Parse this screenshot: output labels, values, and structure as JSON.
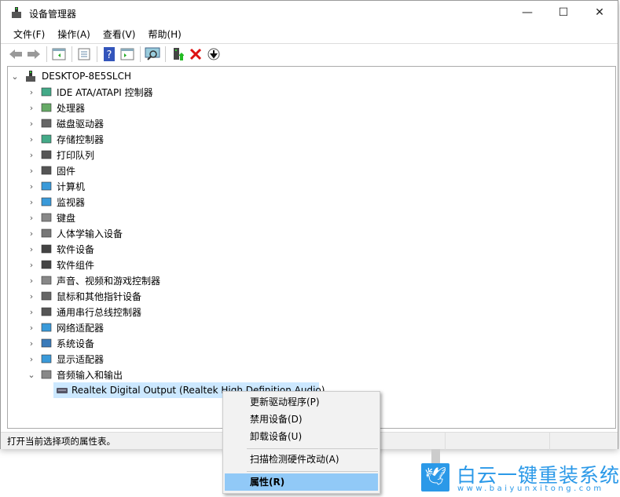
{
  "window": {
    "title": "设备管理器",
    "minimize": "—",
    "maximize": "☐",
    "close": "✕"
  },
  "menu": [
    "文件(F)",
    "操作(A)",
    "查看(V)",
    "帮助(H)"
  ],
  "toolbar": [
    "back",
    "forward",
    "show-hide-console",
    "properties",
    "help",
    "action-pane",
    "scan-hardware",
    "update-driver",
    "uninstall",
    "disable"
  ],
  "tree": {
    "root": "DESKTOP-8E5SLCH",
    "categories": [
      "IDE ATA/ATAPI 控制器",
      "处理器",
      "磁盘驱动器",
      "存储控制器",
      "打印队列",
      "固件",
      "计算机",
      "监视器",
      "键盘",
      "人体学输入设备",
      "软件设备",
      "软件组件",
      "声音、视频和游戏控制器",
      "鼠标和其他指针设备",
      "通用串行总线控制器",
      "网络适配器",
      "系统设备",
      "显示适配器",
      "音频输入和输出"
    ],
    "expanded_child": "Realtek Digital Output (Realtek High Definition Audio)"
  },
  "status": "打开当前选择项的属性表。",
  "context_menu": {
    "items": [
      "更新驱动程序(P)",
      "禁用设备(D)",
      "卸载设备(U)",
      "扫描检测硬件改动(A)",
      "属性(R)"
    ],
    "highlighted": "属性(R)"
  },
  "watermark": {
    "name": "白云一键重装系统",
    "url": "www.baiyunxitong.com"
  },
  "colors": {
    "selection": "#cce8ff",
    "menu_highlight": "#91c9f7",
    "brand": "#2b99e8"
  }
}
